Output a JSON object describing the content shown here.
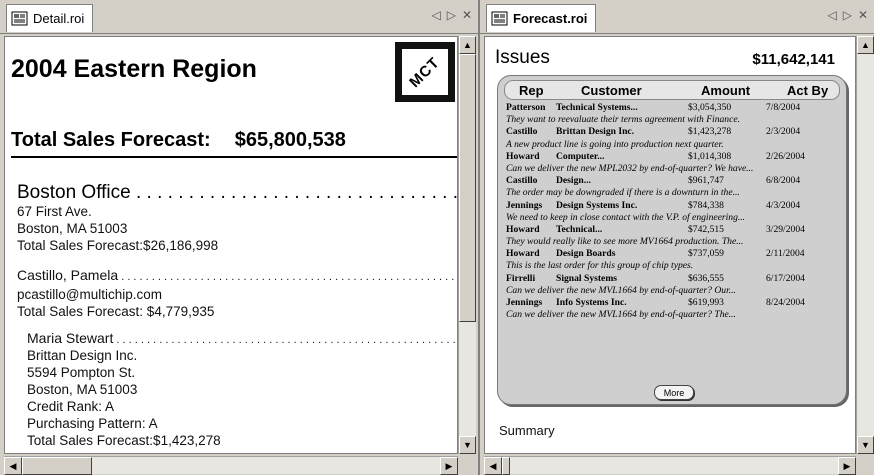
{
  "left": {
    "tab_label": "Detail.roi",
    "tab_controls": [
      "◁",
      "▷",
      "✕"
    ],
    "region_title": "2004 Eastern Region",
    "logo_text": "MCT",
    "total_label": "Total Sales Forecast:",
    "total_value": "$65,800,538",
    "office": {
      "title": "Boston  Office",
      "address1": "67 First Ave.",
      "address2": "Boston, MA  51003",
      "forecast": "Total Sales Forecast:$26,186,998"
    },
    "rep": {
      "name": "Castillo, Pamela",
      "email": "pcastillo@multichip.com",
      "forecast": "Total Sales Forecast:  $4,779,935"
    },
    "customer": {
      "contact": "Maria  Stewart",
      "company": "Brittan Design Inc.",
      "street": "5594 Pompton St.",
      "city": "Boston, MA  51003",
      "credit": "Credit Rank:  A",
      "pattern": "Purchasing Pattern: A",
      "forecast": "Total Sales Forecast:$1,423,278"
    }
  },
  "right": {
    "tab_label": "Forecast.roi",
    "tab_controls": [
      "◁",
      "▷",
      "✕"
    ],
    "issues_title": "Issues",
    "issues_total": "$11,642,141",
    "headers": {
      "rep": "Rep",
      "customer": "Customer",
      "amount": "Amount",
      "act_by": "Act By"
    },
    "rows": [
      {
        "rep": "Patterson",
        "customer": "Technical Systems...",
        "amount": "$3,054,350",
        "date": "7/8/2004",
        "note": "They want to reevaluate their terms agreement with Finance."
      },
      {
        "rep": "Castillo",
        "customer": "Brittan Design Inc.",
        "amount": "$1,423,278",
        "date": "2/3/2004",
        "note": "A new product line is going into production next quarter."
      },
      {
        "rep": "Howard",
        "customer": "Computer...",
        "amount": "$1,014,308",
        "date": "2/26/2004",
        "note": "Can we deliver the new MPL2032 by end-of-quarter? We have..."
      },
      {
        "rep": "Castillo",
        "customer": "Design...",
        "amount": "$961,747",
        "date": "6/8/2004",
        "note": "The order may be downgraded if there is a downturn in the..."
      },
      {
        "rep": "Jennings",
        "customer": "Design Systems Inc.",
        "amount": "$784,338",
        "date": "4/3/2004",
        "note": "We need to keep in close contact with the V.P. of engineering..."
      },
      {
        "rep": "Howard",
        "customer": "Technical...",
        "amount": "$742,515",
        "date": "3/29/2004",
        "note": "They would really like to see more MV1664 production. The..."
      },
      {
        "rep": "Howard",
        "customer": "Design Boards",
        "amount": "$737,059",
        "date": "2/11/2004",
        "note": "This is the last order for this group of chip types."
      },
      {
        "rep": "Firrelli",
        "customer": "Signal Systems",
        "amount": "$636,555",
        "date": "6/17/2004",
        "note": "Can we deliver the new MVL1664 by end-of-quarter? Our..."
      },
      {
        "rep": "Jennings",
        "customer": "Info Systems Inc.",
        "amount": "$619,993",
        "date": "8/24/2004",
        "note": "Can we deliver the new MVL1664 by end-of-quarter? The..."
      }
    ],
    "more_label": "More",
    "summary_label": "Summary"
  }
}
